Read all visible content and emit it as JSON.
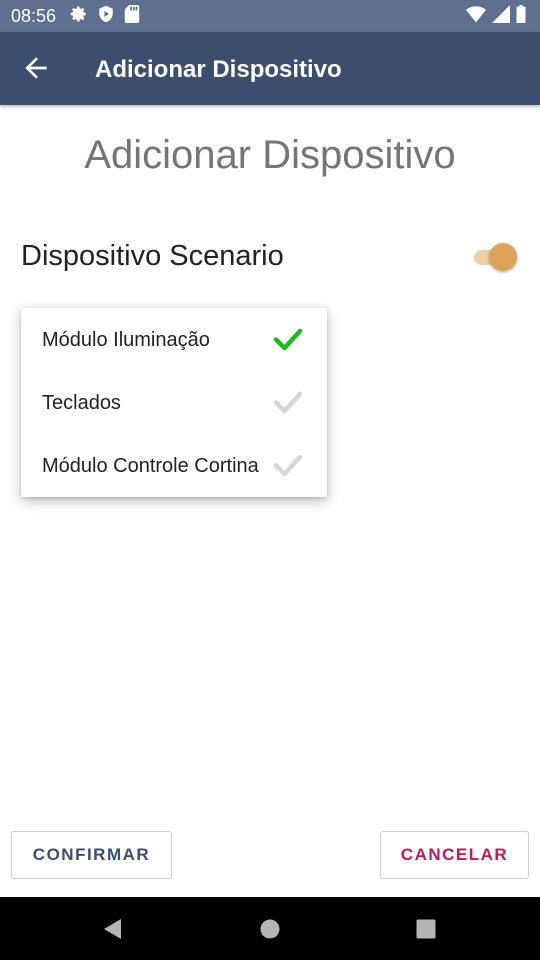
{
  "status_bar": {
    "time": "08:56",
    "icons": [
      "settings-icon",
      "play-protect-icon",
      "sd-card-icon",
      "wifi-icon",
      "signal-icon",
      "battery-icon"
    ]
  },
  "toolbar": {
    "back_icon": "arrow-back-icon",
    "title": "Adicionar Dispositivo"
  },
  "page": {
    "heading": "Adicionar Dispositivo",
    "switch_label": "Dispositivo Scenario",
    "switch_on": true
  },
  "menu": {
    "items": [
      {
        "label": "Módulo Iluminação",
        "checked": true
      },
      {
        "label": "Teclados",
        "checked": false
      },
      {
        "label": "Módulo Controle Cortina",
        "checked": false
      }
    ]
  },
  "buttons": {
    "confirm": "CONFIRMAR",
    "cancel": "CANCELAR"
  },
  "nav_bar": {
    "icons": [
      "back-triangle-icon",
      "home-circle-icon",
      "recents-square-icon"
    ]
  },
  "colors": {
    "status_bar": "#5f6f8f",
    "toolbar": "#3c4e6e",
    "switch_thumb": "#dba45a",
    "check_active": "#1db91d",
    "check_inactive": "#d6d6d6",
    "cancel_text": "#c2185b"
  }
}
